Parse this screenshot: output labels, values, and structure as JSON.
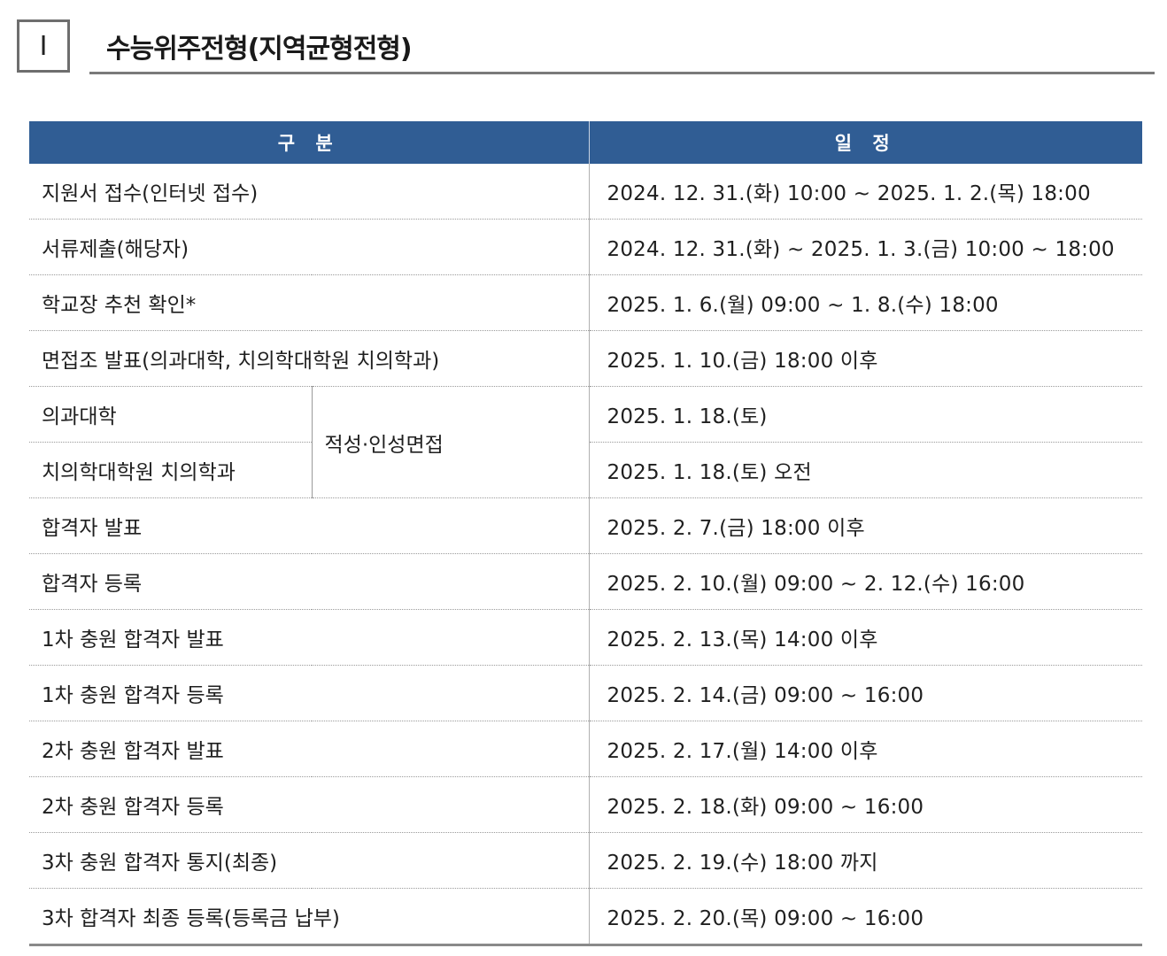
{
  "section": {
    "number": "I",
    "title": "수능위주전형(지역균형전형)"
  },
  "table": {
    "headers": [
      "구 분",
      "일 정"
    ],
    "rows": [
      {
        "label": "지원서 접수(인터넷 접수)",
        "date": "2024. 12. 31.(화) 10:00 ~ 2025. 1. 2.(목) 18:00"
      },
      {
        "label": "서류제출(해당자)",
        "date": "2024. 12. 31.(화) ~ 2025. 1. 3.(금) 10:00 ~ 18:00"
      },
      {
        "label": "학교장 추천 확인*",
        "date": "2025. 1. 6.(월) 09:00 ~ 1. 8.(수) 18:00"
      },
      {
        "label": "면접조 발표(의과대학, 치의학대학원 치의학과)",
        "date": "2025. 1. 10.(금) 18:00 이후"
      }
    ],
    "interview": {
      "merged_label": "적성·인성면접",
      "rows": [
        {
          "label": "의과대학",
          "date": "2025. 1. 18.(토)"
        },
        {
          "label": "치의학대학원 치의학과",
          "date": "2025. 1. 18.(토) 오전"
        }
      ]
    },
    "rows_after": [
      {
        "label": "합격자 발표",
        "date": "2025. 2. 7.(금) 18:00 이후"
      },
      {
        "label": "합격자 등록",
        "date": "2025. 2. 10.(월) 09:00 ~ 2. 12.(수) 16:00"
      },
      {
        "label": "1차 충원 합격자 발표",
        "date": "2025. 2. 13.(목) 14:00 이후"
      },
      {
        "label": "1차 충원 합격자 등록",
        "date": "2025. 2. 14.(금) 09:00 ~ 16:00"
      },
      {
        "label": "2차 충원 합격자 발표",
        "date": "2025. 2. 17.(월) 14:00 이후"
      },
      {
        "label": "2차 충원 합격자 등록",
        "date": "2025. 2. 18.(화) 09:00 ~ 16:00"
      },
      {
        "label": "3차 충원 합격자 통지(최종)",
        "date": "2025. 2. 19.(수) 18:00 까지"
      },
      {
        "label": "3차 합격자 최종 등록(등록금 납부)",
        "date": "2025. 2. 20.(목) 09:00 ~ 16:00"
      }
    ]
  }
}
